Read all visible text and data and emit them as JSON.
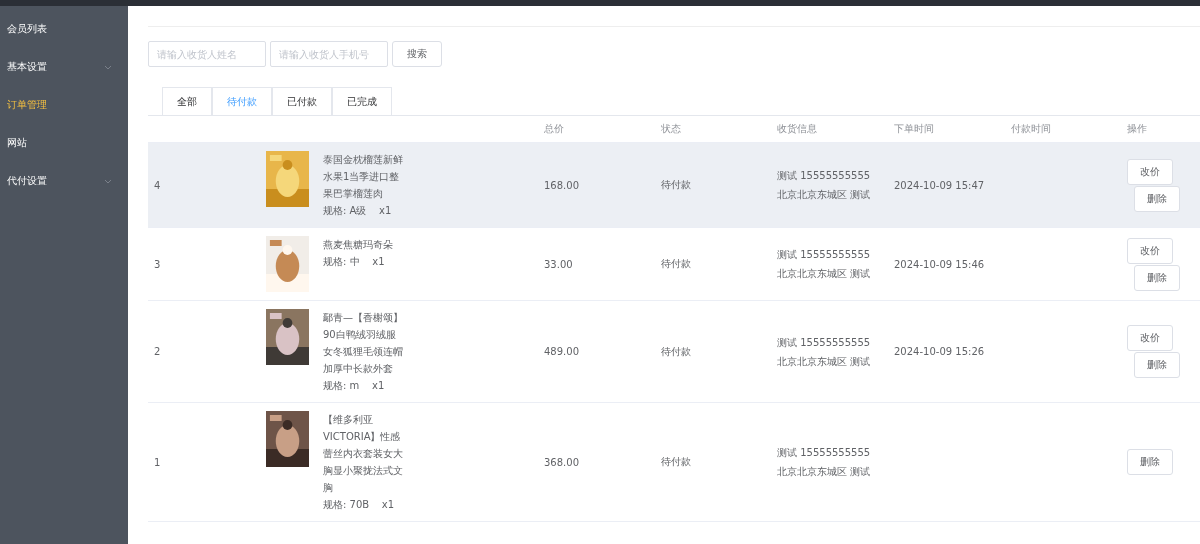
{
  "sidebar": {
    "items": [
      {
        "label": "会员列表",
        "selected": false,
        "expandable": false
      },
      {
        "label": "基本设置",
        "selected": false,
        "expandable": true
      },
      {
        "label": "订单管理",
        "selected": true,
        "expandable": false
      },
      {
        "label": "网站",
        "selected": false,
        "expandable": false
      },
      {
        "label": "代付设置",
        "selected": false,
        "expandable": true
      }
    ]
  },
  "search": {
    "fields": [
      {
        "placeholder": "请输入收货人姓名"
      },
      {
        "placeholder": "请输入收货人手机号"
      }
    ],
    "button": "搜索"
  },
  "tabs": [
    {
      "label": "全部",
      "selected": false
    },
    {
      "label": "待付款",
      "selected": true
    },
    {
      "label": "已付款",
      "selected": false
    },
    {
      "label": "已完成",
      "selected": false
    }
  ],
  "table": {
    "columns": [
      "总价",
      "状态",
      "收货信息",
      "下单时间",
      "付款时间",
      "操作"
    ],
    "rows": [
      {
        "id": "4",
        "highlighted": true,
        "product": {
          "kind": "picture"
        },
        "title": "泰国金枕榴莲新鲜水果1当季进口整果巴掌榴莲肉",
        "spec": "规格: A级    x1",
        "price": "168.00",
        "status": "待付款",
        "address": "测试 15555555555 北京北京东城区 测试",
        "created": "2024-10-09 15:47",
        "actions": [
          "改价",
          "删除"
        ]
      },
      {
        "id": "3",
        "highlighted": false,
        "product": {
          "kind": "picture"
        },
        "title": "燕麦焦糖玛奇朵",
        "spec": "规格: 中    x1",
        "price": "33.00",
        "status": "待付款",
        "address": "测试 15555555555 北京北京东城区 测试",
        "created": "2024-10-09 15:46",
        "actions": [
          "改价",
          "删除"
        ]
      },
      {
        "id": "2",
        "highlighted": false,
        "product": {
          "kind": "picture"
        },
        "title": "鄢青—【香榭颂】90白鸭绒羽绒服女冬狐狸毛领连帽加厚中长款外套",
        "spec": "规格: m    x1",
        "price": "489.00",
        "status": "待付款",
        "address": "测试 15555555555 北京北京东城区 测试",
        "created": "2024-10-09 15:26",
        "actions": [
          "改价",
          "删除"
        ]
      },
      {
        "id": "1",
        "highlighted": false,
        "product": {
          "kind": "picture"
        },
        "title": "【维多利亚 VICTORIA】性感蕾丝内衣套装女大胸显小聚拢法式文胸",
        "spec": "规格: 70B    x1",
        "price": "368.00",
        "status": "待付款",
        "address": "测试 15555555555 北京北京东城区 测试",
        "actions": [
          "删除"
        ]
      }
    ]
  }
}
